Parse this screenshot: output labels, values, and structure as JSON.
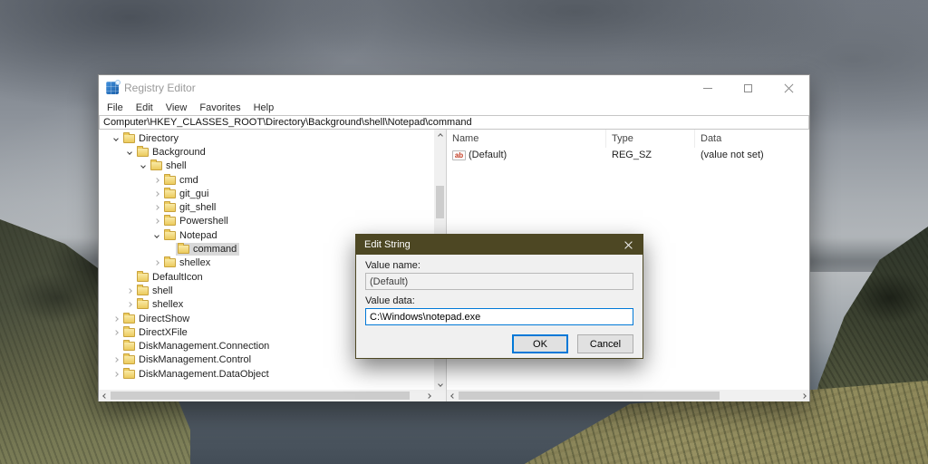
{
  "colors": {
    "accent": "#0078d7",
    "dialog_titlebar": "#4d4723",
    "selection": "#d9d9d9",
    "folder": "#eccb5e",
    "window_chrome": "#ffffff"
  },
  "icons": {
    "registry_editor": "blue-grid-app-icon",
    "minimize": "thin-horizontal-line",
    "maximize": "outline-square",
    "close": "diagonal-cross",
    "tree_expanded": "chevron-down",
    "tree_collapsed": "chevron-right",
    "tree_node": "yellow-folder",
    "string_value": "ab-letters-page",
    "scroll_arrows": "chevron-up-down-left-right"
  },
  "window": {
    "title": "Registry Editor",
    "menu": [
      "File",
      "Edit",
      "View",
      "Favorites",
      "Help"
    ],
    "address": "Computer\\HKEY_CLASSES_ROOT\\Directory\\Background\\shell\\Notepad\\command",
    "tree": [
      {
        "label": "Directory",
        "level": 0,
        "state": "expanded",
        "selected": false
      },
      {
        "label": "Background",
        "level": 1,
        "state": "expanded",
        "selected": false
      },
      {
        "label": "shell",
        "level": 2,
        "state": "expanded",
        "selected": false
      },
      {
        "label": "cmd",
        "level": 3,
        "state": "collapsed",
        "selected": false
      },
      {
        "label": "git_gui",
        "level": 3,
        "state": "collapsed",
        "selected": false
      },
      {
        "label": "git_shell",
        "level": 3,
        "state": "collapsed",
        "selected": false
      },
      {
        "label": "Powershell",
        "level": 3,
        "state": "collapsed",
        "selected": false
      },
      {
        "label": "Notepad",
        "level": 3,
        "state": "expanded",
        "selected": false
      },
      {
        "label": "command",
        "level": 4,
        "state": "leaf",
        "selected": true
      },
      {
        "label": "shellex",
        "level": 3,
        "state": "collapsed",
        "selected": false
      },
      {
        "label": "DefaultIcon",
        "level": 1,
        "state": "leaf",
        "selected": false
      },
      {
        "label": "shell",
        "level": 1,
        "state": "collapsed",
        "selected": false
      },
      {
        "label": "shellex",
        "level": 1,
        "state": "collapsed",
        "selected": false
      },
      {
        "label": "DirectShow",
        "level": 0,
        "state": "collapsed",
        "selected": false
      },
      {
        "label": "DirectXFile",
        "level": 0,
        "state": "collapsed",
        "selected": false
      },
      {
        "label": "DiskManagement.Connection",
        "level": 0,
        "state": "leaf",
        "selected": false
      },
      {
        "label": "DiskManagement.Control",
        "level": 0,
        "state": "collapsed",
        "selected": false
      },
      {
        "label": "DiskManagement.DataObject",
        "level": 0,
        "state": "collapsed",
        "selected": false
      }
    ],
    "list": {
      "columns": [
        "Name",
        "Type",
        "Data"
      ],
      "rows": [
        {
          "icon": "string-value-icon",
          "icon_text": "ab",
          "name": "(Default)",
          "type": "REG_SZ",
          "data": "(value not set)"
        }
      ]
    }
  },
  "dialog": {
    "title": "Edit String",
    "value_name_label": "Value name:",
    "value_name": "(Default)",
    "value_data_label": "Value data:",
    "value_data": "C:\\Windows\\notepad.exe",
    "ok_label": "OK",
    "cancel_label": "Cancel"
  }
}
